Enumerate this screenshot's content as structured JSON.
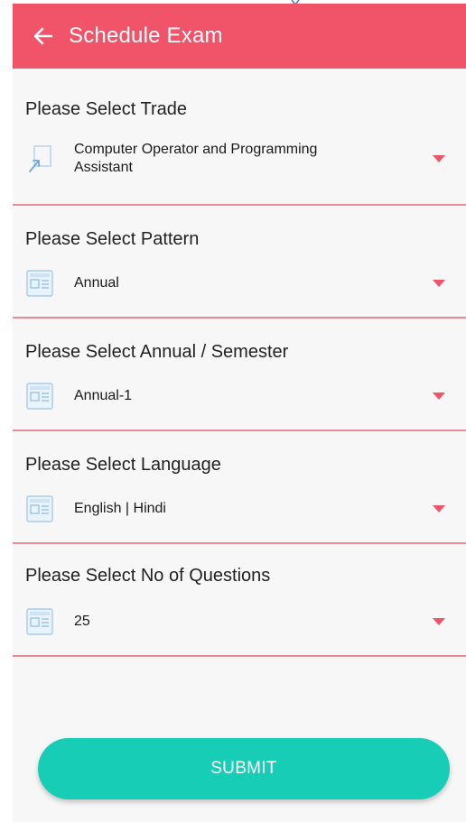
{
  "app_bar": {
    "title": "Schedule Exam",
    "back_icon": "arrow-left-icon",
    "color": "#f15468"
  },
  "fields": [
    {
      "label": "Please Select Trade",
      "value": "Computer Operator and Programming\nAssistant",
      "icon": "pointer-cursor-icon"
    },
    {
      "label": "Please Select Pattern",
      "value": "Annual",
      "icon": "document-list-icon"
    },
    {
      "label": "Please Select Annual / Semester",
      "value": "Annual-1",
      "icon": "document-list-icon"
    },
    {
      "label": "Please Select Language",
      "value": "English | Hindi",
      "icon": "document-list-icon"
    },
    {
      "label": "Please Select No of Questions",
      "value": "25",
      "icon": "document-list-icon"
    }
  ],
  "submit": {
    "label": "SUBMIT",
    "color": "#18cdb6"
  },
  "colors": {
    "accent": "#f15468",
    "divider": "#e88b96",
    "dropdown_arrow": "#f15468"
  }
}
